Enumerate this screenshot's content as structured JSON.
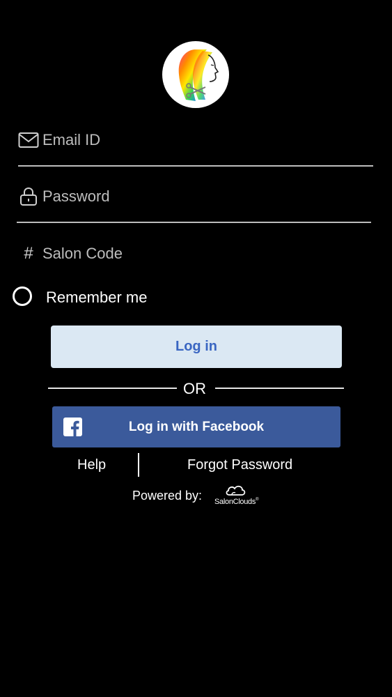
{
  "logo": {
    "icon": "salon-woman-rainbow-hair-logo"
  },
  "form": {
    "email": {
      "placeholder": "Email ID",
      "value": "",
      "icon": "envelope-icon"
    },
    "password": {
      "placeholder": "Password",
      "value": "",
      "icon": "lock-icon"
    },
    "salon_code": {
      "placeholder": "Salon Code",
      "value": "",
      "icon": "hash-icon",
      "icon_glyph": "#"
    },
    "remember_me": {
      "label": "Remember me",
      "checked": false
    }
  },
  "actions": {
    "login_label": "Log in",
    "or_label": "OR",
    "facebook_label": "Log in with Facebook",
    "help_label": "Help",
    "forgot_label": "Forgot Password"
  },
  "footer": {
    "powered_by": "Powered by:",
    "brand": "SalonClouds",
    "brand_mark": "®"
  },
  "colors": {
    "background": "#000000",
    "login_button_bg": "#dbe8f3",
    "login_button_text": "#3a66c2",
    "facebook_blue": "#3b5a9b",
    "placeholder": "#bdbdbd"
  }
}
